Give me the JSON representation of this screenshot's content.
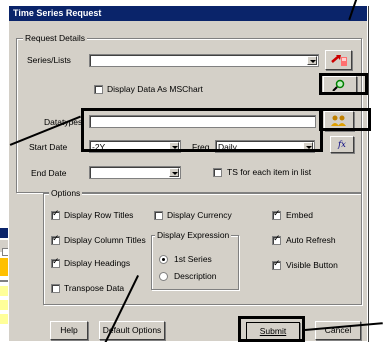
{
  "dialog": {
    "title": "Time Series Request",
    "request_group": "Request Details",
    "options_group": "Options",
    "expression_group": "Display Expression"
  },
  "fields": {
    "series_label": "Series/Lists",
    "series_value": "",
    "msc_label": "Display Data As MSChart",
    "msc_checked": false,
    "datatypes_label": "Datatypes",
    "datatypes_value": "",
    "start_label": "Start Date",
    "start_value": "-2Y",
    "freq_label": "Freq",
    "freq_value": "Daily",
    "end_label": "End Date",
    "end_value": "",
    "ts_label": "TS for each item in list",
    "ts_checked": false
  },
  "options": {
    "row_titles": {
      "label": "Display Row Titles",
      "checked": true
    },
    "col_titles": {
      "label": "Display Column Titles",
      "checked": true
    },
    "headings": {
      "label": "Display Headings",
      "checked": true
    },
    "transpose": {
      "label": "Transpose Data",
      "checked": false
    },
    "currency": {
      "label": "Display Currency",
      "checked": false
    },
    "embed": {
      "label": "Embed",
      "checked": true
    },
    "auto_refresh": {
      "label": "Auto Refresh",
      "checked": true
    },
    "visible_button": {
      "label": "Visible Button",
      "checked": true
    },
    "first_series": {
      "label": "1st Series",
      "selected": true
    },
    "description": {
      "label": "Description",
      "selected": false
    }
  },
  "buttons": {
    "help": "Help",
    "default_options": "Default Options",
    "submit": "Submit",
    "cancel": "Cancel",
    "fx": "fx"
  },
  "colors": {
    "title_bar": "#0a246a",
    "face": "#d4d0c8",
    "sheet_orange": "#ffc000",
    "sheet_yellow": "#ffff99"
  },
  "icons": {
    "series_picker": "arrow-grid-icon",
    "series_find": "magnifier-icon",
    "datatype_find": "people-icon",
    "function": "fx-icon"
  }
}
